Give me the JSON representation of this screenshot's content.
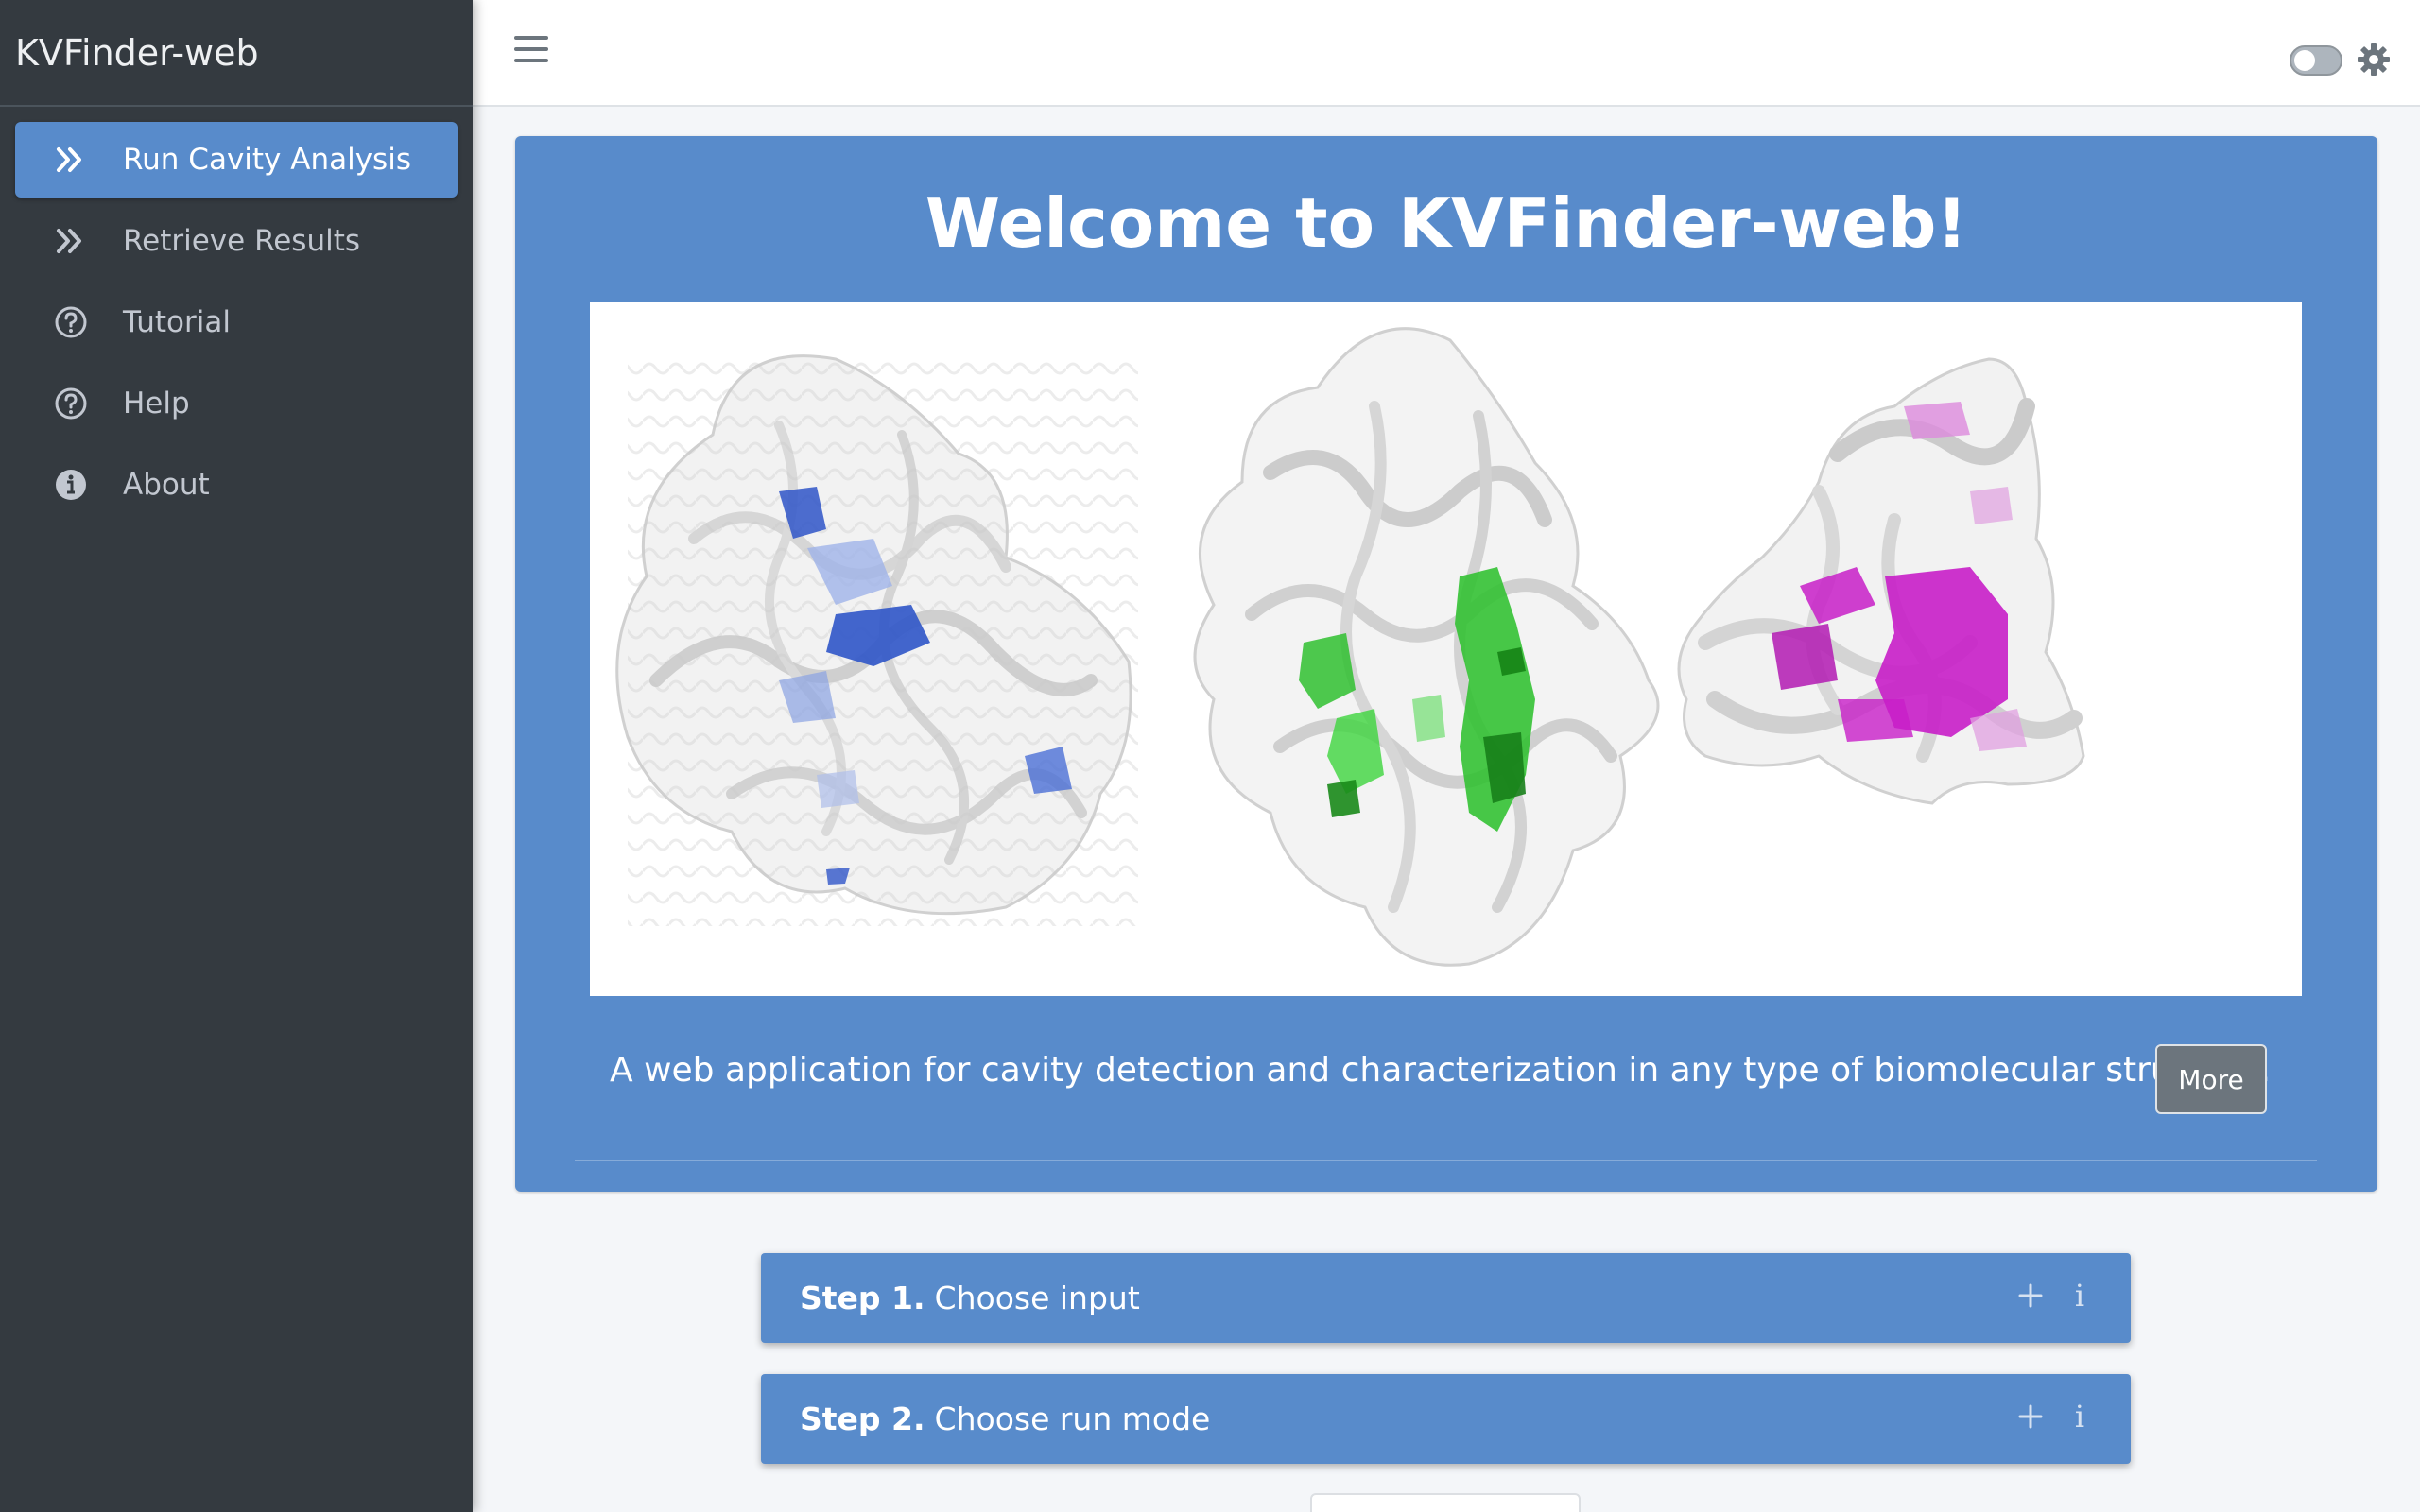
{
  "app": {
    "brand": "KVFinder-web"
  },
  "sidebar": {
    "items": [
      {
        "label": "Run Cavity Analysis",
        "icon": "double-chevron-right-icon",
        "active": true
      },
      {
        "label": "Retrieve Results",
        "icon": "double-chevron-right-icon",
        "active": false
      },
      {
        "label": "Tutorial",
        "icon": "question-circle-icon",
        "active": false
      },
      {
        "label": "Help",
        "icon": "question-circle-icon",
        "active": false
      },
      {
        "label": "About",
        "icon": "info-circle-icon",
        "active": false
      }
    ]
  },
  "topbar": {
    "menu_icon": "hamburger-icon",
    "dark_mode_toggle": false,
    "settings_icon": "gear-icon"
  },
  "welcome": {
    "title": "Welcome to KVFinder-web!",
    "tagline": "A web application for cavity detection and characterization in any type of biomolecular structure.",
    "more_label": "More",
    "image_colors": [
      "#2f55c8",
      "#2fc02f",
      "#c81ec8"
    ]
  },
  "steps": [
    {
      "number": "Step 1.",
      "title": "Choose input"
    },
    {
      "number": "Step 2.",
      "title": "Choose run mode"
    }
  ],
  "colors": {
    "sidebar_bg": "#343a40",
    "accent": "#588bcb",
    "button_secondary": "#6c757d"
  }
}
